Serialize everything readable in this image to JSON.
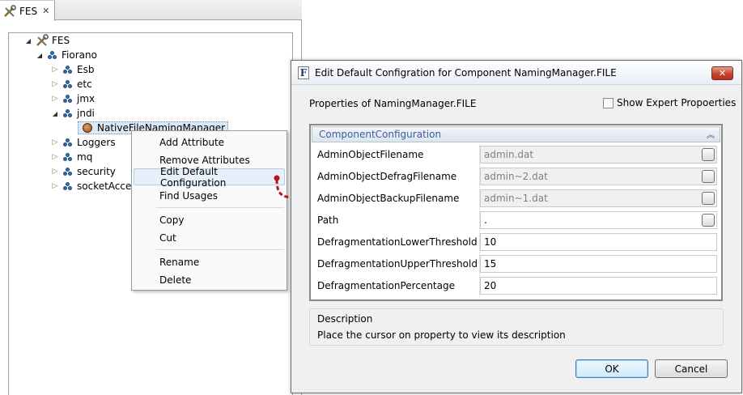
{
  "view": {
    "tab_label": "FES",
    "close_glyph": "✕"
  },
  "tree": {
    "root": "FES",
    "fiorano": "Fiorano",
    "children": [
      "Esb",
      "etc",
      "jmx",
      "jndi",
      "Loggers",
      "mq",
      "security",
      "socketAcce"
    ],
    "jndi_child": "NativeFileNamingManager"
  },
  "context_menu": {
    "items": [
      "Add Attribute",
      "Remove Attributes",
      "Edit Default Configuration",
      "Find Usages",
      "Copy",
      "Cut",
      "Rename",
      "Delete"
    ]
  },
  "dialog": {
    "title": "Edit Default Configration for Component NamingManager.FILE",
    "app_icon_letter": "F",
    "close_glyph": "✕",
    "properties_label": "Properties of NamingManager.FILE",
    "show_expert_label": "Show Expert Propoerties",
    "group_title": "ComponentConfiguration",
    "collapse_glyph": "︽",
    "properties": [
      {
        "name": "AdminObjectFilename",
        "value": "admin.dat"
      },
      {
        "name": "AdminObjectDefragFilename",
        "value": "admin~2.dat"
      },
      {
        "name": "AdminObjectBackupFilename",
        "value": "admin~1.dat"
      },
      {
        "name": "Path",
        "value": "."
      },
      {
        "name": "DefragmentationLowerThreshold",
        "value": "10"
      },
      {
        "name": "DefragmentationUpperThreshold",
        "value": "15"
      },
      {
        "name": "DefragmentationPercentage",
        "value": "20"
      }
    ],
    "description_title": "Description",
    "description_text": "Place the cursor on property to view its description",
    "ok_label": "OK",
    "cancel_label": "Cancel"
  },
  "colors": {
    "group_title": "#3a5fa0",
    "arrow": "#b01818",
    "close_button": "#c7422d"
  }
}
